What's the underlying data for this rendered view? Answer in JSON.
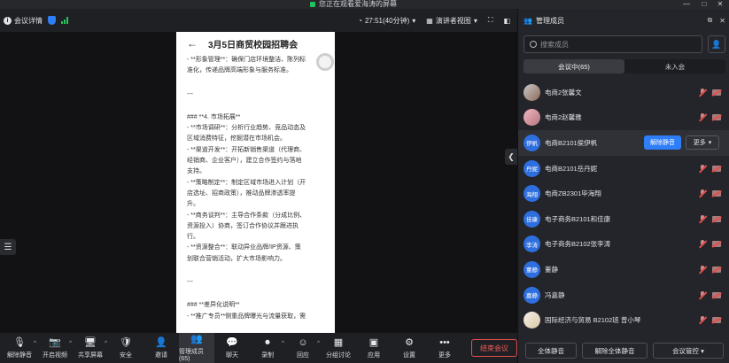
{
  "titlebar": {
    "sharing_text": "您正在观看爱海涛的屏幕",
    "controls": [
      "—",
      "□",
      "✕"
    ]
  },
  "topbar": {
    "meeting_info_label": "会议详情",
    "timer": "27:51(40分钟)",
    "speaker_view_label": "演讲者视图"
  },
  "shared_screen": {
    "back_arrow": "←",
    "title": "3月5日商贸校园招聘会",
    "lines": [
      "- **形象管理**：确保门店环境整洁、陈列标",
      "准化，传递品牌高端形象与服务标准。",
      "",
      "---",
      "",
      "### **4. 市场拓展**",
      "- **市场调研**：分析行业趋势、竞品动态及",
      "区域消费特征，挖掘潜在市场机会。",
      "- **渠道开发**：开拓新销售渠道（代理商、",
      "经销商、企业客户），建立合作签约与落地",
      "支持。",
      "- **策略制定**：制定区域市场进入计划（开",
      "店选址、招商政策），推动品牌渗透率提",
      "升。",
      "- **商务谈判**：主导合作条款（分成比例、",
      "资源投入）协商，签订合作协议并跟进执",
      "行。",
      "- **资源整合**：联动异业品牌/IP资源、策",
      "划联合营销活动，扩大市场影响力。",
      "",
      "---",
      "",
      "### **差异化说明**",
      "- **推广专员**侧重品牌曝光与流量获取，需"
    ]
  },
  "bottombar": {
    "items": [
      {
        "label": "解除静音",
        "icon": "mic-off-icon",
        "glyph": "🎙",
        "caret": true
      },
      {
        "label": "开启视频",
        "icon": "video-off-icon",
        "glyph": "📷",
        "caret": true
      },
      {
        "label": "共享屏幕",
        "icon": "share-screen-icon",
        "glyph": "🖥",
        "caret": true
      },
      {
        "label": "安全",
        "icon": "shield-icon",
        "glyph": "🛡",
        "caret": false
      },
      {
        "label": "邀请",
        "icon": "invite-icon",
        "glyph": "👤",
        "caret": false
      },
      {
        "label": "管理成员(65)",
        "icon": "members-icon",
        "glyph": "👥",
        "caret": false,
        "active": true
      },
      {
        "label": "聊天",
        "icon": "chat-icon",
        "glyph": "💬",
        "caret": false
      },
      {
        "label": "录制",
        "icon": "record-icon",
        "glyph": "⏺",
        "caret": true
      },
      {
        "label": "回应",
        "icon": "reaction-icon",
        "glyph": "☺",
        "caret": true
      },
      {
        "label": "分组讨论",
        "icon": "breakout-icon",
        "glyph": "▦",
        "caret": false
      },
      {
        "label": "应用",
        "icon": "apps-icon",
        "glyph": "▣",
        "caret": false
      },
      {
        "label": "设置",
        "icon": "settings-icon",
        "glyph": "⚙",
        "caret": false
      },
      {
        "label": "更多",
        "icon": "more-icon",
        "glyph": "•••",
        "caret": false
      }
    ],
    "end_meeting_label": "结束会议"
  },
  "panel": {
    "title": "管理成员",
    "search_placeholder": "搜索成员",
    "tabs": [
      {
        "label": "会议中(65)",
        "active": true
      },
      {
        "label": "未入会",
        "active": false
      }
    ],
    "members": [
      {
        "avatar": "img",
        "avatar_text": "",
        "name": "电商2张馨文"
      },
      {
        "avatar": "img2",
        "avatar_text": "",
        "name": "电商2赵馨雅"
      },
      {
        "avatar": "txt",
        "avatar_text": "伊帆",
        "name": "电商B2101侯伊帆",
        "highlight": true
      },
      {
        "avatar": "txt",
        "avatar_text": "丹妮",
        "name": "电商B2101岳丹妮"
      },
      {
        "avatar": "txt",
        "avatar_text": "海翔",
        "name": "电商ZB2301毕海翔"
      },
      {
        "avatar": "txt",
        "avatar_text": "佳康",
        "name": "电子商务B2101和佳康"
      },
      {
        "avatar": "txt",
        "avatar_text": "李涛",
        "name": "电子商务B2102张李涛"
      },
      {
        "avatar": "txt",
        "avatar_text": "董静",
        "name": "董静"
      },
      {
        "avatar": "txt",
        "avatar_text": "嘉静",
        "name": "冯嘉静"
      },
      {
        "avatar": "img3",
        "avatar_text": "",
        "name": "国际经济与贸易 B2102班 曾小琴"
      }
    ],
    "unmute_label": "解除静音",
    "more_label": "更多",
    "footer": {
      "mute_all": "全体静音",
      "unmute_all": "解除全体静音",
      "meeting_control": "会议管控"
    }
  }
}
